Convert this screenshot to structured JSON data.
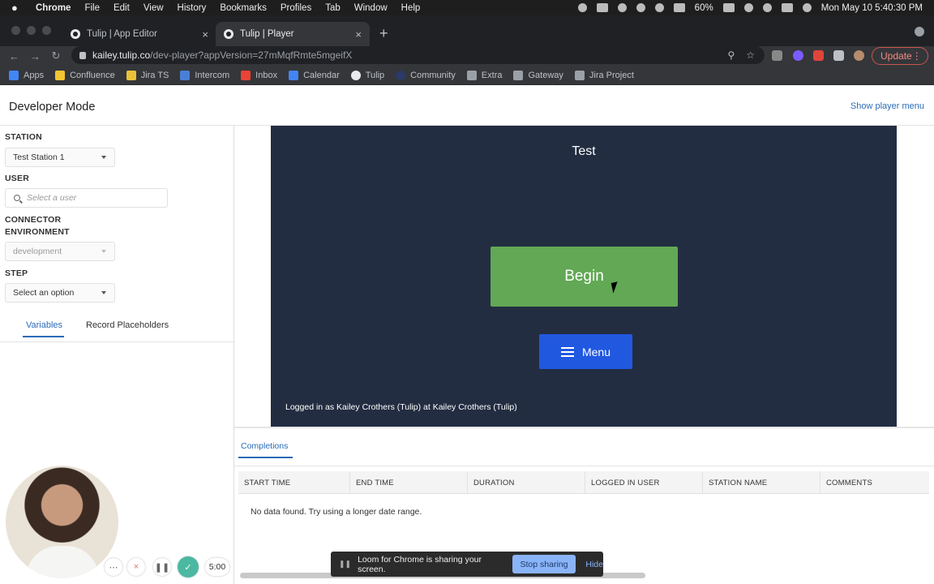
{
  "menubar": {
    "apple": "",
    "app": "Chrome",
    "items": [
      "File",
      "Edit",
      "View",
      "History",
      "Bookmarks",
      "Profiles",
      "Tab",
      "Window",
      "Help"
    ],
    "battery": "60%",
    "datetime": "Mon May 10  5:40:30 PM"
  },
  "tabs": [
    {
      "title": "Tulip | App Editor",
      "active": false
    },
    {
      "title": "Tulip | Player",
      "active": true
    }
  ],
  "omnibox": {
    "host": "kailey.tulip.co",
    "path": "/dev-player?appVersion=27mMqfRmte5mgeifX"
  },
  "update_label": "Update",
  "bookmarks": [
    "Apps",
    "Confluence",
    "Jira TS",
    "Intercom",
    "Inbox",
    "Calendar",
    "Tulip",
    "Community",
    "Extra",
    "Gateway",
    "Jira Project"
  ],
  "devbar": {
    "title": "Developer Mode",
    "show_player_menu": "Show player menu"
  },
  "left": {
    "station_label": "STATION",
    "station_value": "Test Station 1",
    "user_label": "USER",
    "user_placeholder": "Select a user",
    "connector_label_1": "CONNECTOR",
    "connector_label_2": "ENVIRONMENT",
    "connector_value": "development",
    "step_label": "STEP",
    "step_value": "Select an option",
    "tabs": [
      "Variables",
      "Record Placeholders"
    ]
  },
  "player": {
    "title": "Test",
    "begin_label": "Begin",
    "menu_label": "Menu",
    "logged_in": "Logged in as Kailey Crothers (Tulip) at Kailey Crothers (Tulip)"
  },
  "completions": {
    "tab": "Completions",
    "columns": [
      "START TIME",
      "END TIME",
      "DURATION",
      "LOGGED IN USER",
      "STATION NAME",
      "COMMENTS"
    ],
    "empty": "No data found. Try using a longer date range."
  },
  "loom": {
    "timer": "5:00",
    "sharing_text": "Loom for Chrome is sharing your screen.",
    "stop_label": "Stop sharing",
    "hide_label": "Hide"
  },
  "colors": {
    "player_bg": "#232d42",
    "begin_green": "#62a855",
    "menu_blue": "#2158e0",
    "link_blue": "#2a6bb8"
  }
}
